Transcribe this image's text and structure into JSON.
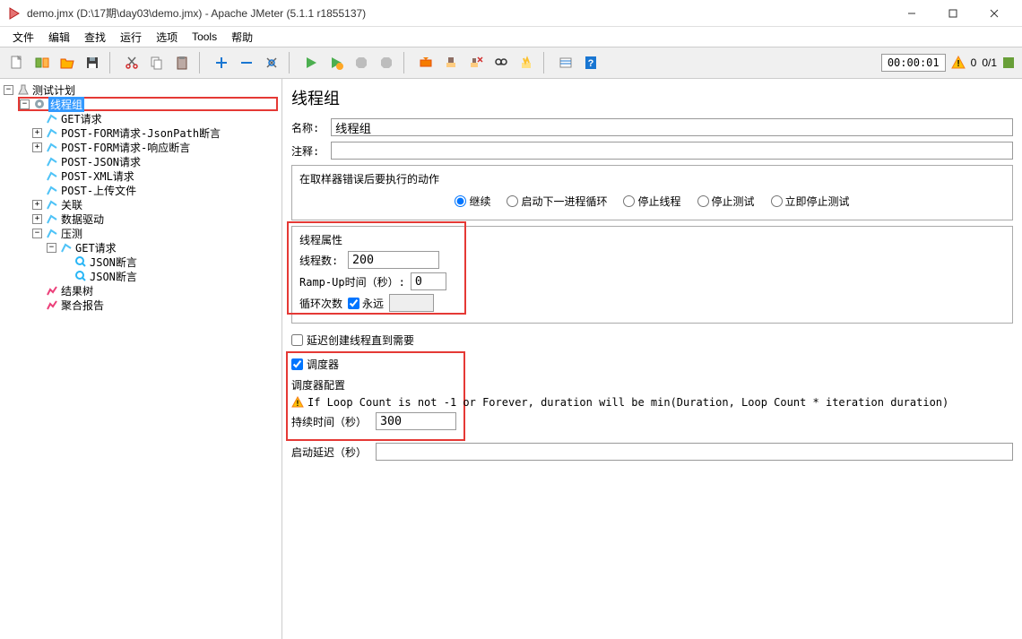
{
  "window": {
    "title": "demo.jmx (D:\\17期\\day03\\demo.jmx) - Apache JMeter (5.1.1 r1855137)"
  },
  "menu": [
    "文件",
    "编辑",
    "查找",
    "运行",
    "选项",
    "Tools",
    "帮助"
  ],
  "toolbar": {
    "timer": "00:00:01",
    "warn_count": "0",
    "thread_status": "0/1"
  },
  "tree": {
    "root": "测试计划",
    "thread_group": "线程组",
    "items": [
      "GET请求",
      "POST-FORM请求-JsonPath断言",
      "POST-FORM请求-响应断言",
      "POST-JSON请求",
      "POST-XML请求",
      "POST-上传文件",
      "关联",
      "数据驱动",
      "压测"
    ],
    "sub_get": "GET请求",
    "json_assert1": "JSON断言",
    "json_assert2": "JSON断言",
    "result_tree": "结果树",
    "agg_report": "聚合报告"
  },
  "panel": {
    "title": "线程组",
    "name_label": "名称:",
    "name_value": "线程组",
    "comment_label": "注释:",
    "comment_value": "",
    "on_error_legend": "在取样器错误后要执行的动作",
    "on_error": [
      "继续",
      "启动下一进程循环",
      "停止线程",
      "停止测试",
      "立即停止测试"
    ],
    "thread_props_legend": "线程属性",
    "threads_label": "线程数:",
    "threads_value": "200",
    "rampup_label": "Ramp-Up时间（秒）:",
    "rampup_value": "0",
    "loop_label": "循环次数",
    "forever_label": "永远",
    "delay_create_label": "延迟创建线程直到需要",
    "scheduler_label": "调度器",
    "scheduler_legend": "调度器配置",
    "warn_text": "If Loop Count is not -1 or Forever, duration will be min(Duration, Loop Count * iteration duration)",
    "duration_label": "持续时间（秒）",
    "duration_value": "300",
    "startup_delay_label": "启动延迟（秒）",
    "startup_delay_value": ""
  }
}
